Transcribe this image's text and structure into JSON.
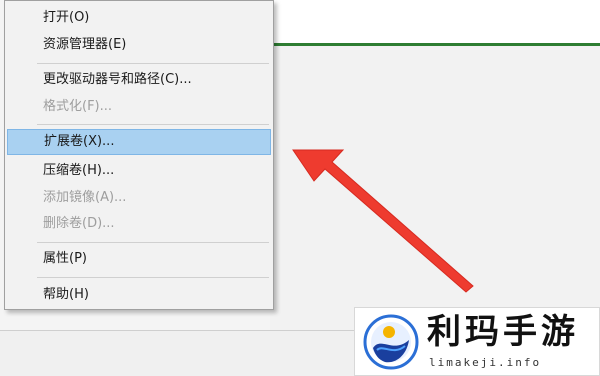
{
  "context_menu": {
    "items": [
      {
        "label": "打开(O)",
        "enabled": true
      },
      {
        "label": "资源管理器(E)",
        "enabled": true
      },
      {
        "label": "更改驱动器号和路径(C)...",
        "enabled": true
      },
      {
        "label": "格式化(F)...",
        "enabled": false
      },
      {
        "label": "扩展卷(X)...",
        "enabled": true,
        "highlighted": true
      },
      {
        "label": "压缩卷(H)...",
        "enabled": true
      },
      {
        "label": "添加镜像(A)...",
        "enabled": false
      },
      {
        "label": "删除卷(D)...",
        "enabled": false
      },
      {
        "label": "属性(P)",
        "enabled": true
      },
      {
        "label": "帮助(H)",
        "enabled": true
      }
    ]
  },
  "annotation": {
    "type": "arrow",
    "color": "#ee3b2f",
    "points_to": "扩展卷(X)..."
  },
  "watermark": {
    "title": "利玛手游",
    "url": "limakeji.info",
    "icon": "swirl-logo-icon",
    "colors": {
      "ring": "#2b6fd6",
      "wave": "#1a3f9e",
      "dot": "#f5b400"
    }
  },
  "colors": {
    "menu_background": "#f2f2f2",
    "highlight": "#a9d1f1",
    "disabled_text": "#9e9e9e",
    "accent_line": "#2e7d32"
  }
}
